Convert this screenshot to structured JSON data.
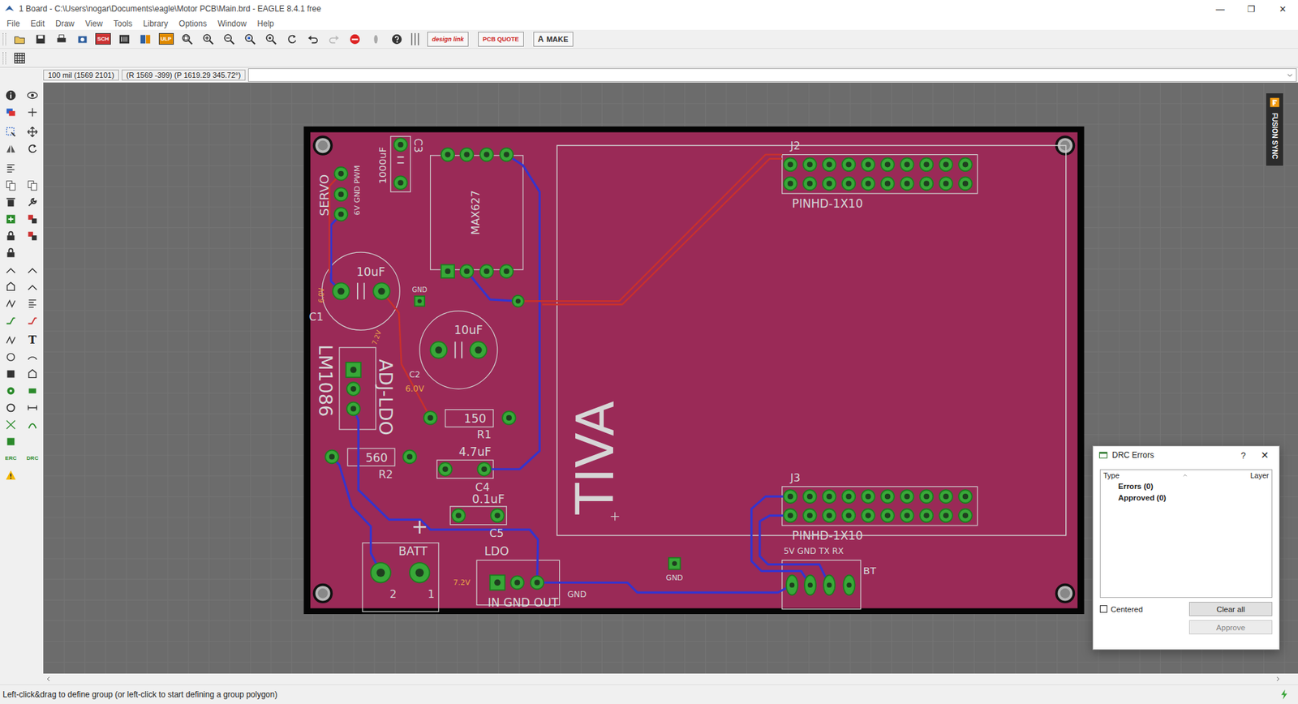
{
  "window": {
    "title": "1 Board - C:\\Users\\nogar\\Documents\\eagle\\Motor PCB\\Main.brd - EAGLE 8.4.1 free",
    "controls": [
      "—",
      "❐",
      "✕"
    ]
  },
  "menu": [
    "File",
    "Edit",
    "Draw",
    "View",
    "Tools",
    "Library",
    "Options",
    "Window",
    "Help"
  ],
  "toolbar": {
    "icon_labels": [
      "SCH",
      "ULP"
    ],
    "text_buttons": [
      {
        "label": "design link"
      },
      {
        "label": "PCB QUOTE"
      },
      {
        "label": "MAKE",
        "logo": "A"
      }
    ]
  },
  "coordinates": {
    "grid": "100 mil (1569 2101)",
    "position": "(R 1569 -399) (P 1619.29 345.72°)",
    "command": ""
  },
  "left_toolbar": {
    "text_icons": [
      "T",
      "ERC",
      "DRC"
    ]
  },
  "fusion_sync": {
    "label": "FUSION SYNC"
  },
  "board": {
    "labels": [
      {
        "text": "SERVO"
      },
      {
        "text": "6V GND PWM"
      },
      {
        "text": "1000uF"
      },
      {
        "text": "C3"
      },
      {
        "text": "MAX627"
      },
      {
        "text": "10uF"
      },
      {
        "text": "C1"
      },
      {
        "text": "GND"
      },
      {
        "text": "10uF"
      },
      {
        "text": "C2"
      },
      {
        "text": "6.0V"
      },
      {
        "text": "LM1086"
      },
      {
        "text": "ADJ-LDO"
      },
      {
        "text": "150"
      },
      {
        "text": "R1"
      },
      {
        "text": "560"
      },
      {
        "text": "R2"
      },
      {
        "text": "4.7uF"
      },
      {
        "text": "C4"
      },
      {
        "text": "0.1uF"
      },
      {
        "text": "C5"
      },
      {
        "text": "BATT"
      },
      {
        "text": "2"
      },
      {
        "text": "1"
      },
      {
        "text": "+"
      },
      {
        "text": "LDO"
      },
      {
        "text": "IN GND OUT"
      },
      {
        "text": "7.2V"
      },
      {
        "text": "GND"
      },
      {
        "text": "GND"
      },
      {
        "text": "TIVA"
      },
      {
        "text": "J2"
      },
      {
        "text": "PINHD-1X10"
      },
      {
        "text": "J3"
      },
      {
        "text": "PINHD-1X10"
      },
      {
        "text": "5V GND TX RX"
      },
      {
        "text": "BT"
      },
      {
        "text": "6.0V"
      },
      {
        "text": "7.2V"
      }
    ]
  },
  "drc_dialog": {
    "title": "DRC Errors",
    "help": "?",
    "close": "✕",
    "columns": [
      "Type",
      "Layer"
    ],
    "items": [
      {
        "label": "Errors (0)"
      },
      {
        "label": "Approved (0)"
      }
    ],
    "centered": {
      "label": "Centered",
      "checked": false
    },
    "buttons": [
      {
        "label": "Clear all",
        "disabled": false
      },
      {
        "label": "Approve",
        "disabled": true
      }
    ]
  },
  "status_bar": {
    "text": "Left-click&drag to define group (or left-click to start defining a group polygon)"
  }
}
